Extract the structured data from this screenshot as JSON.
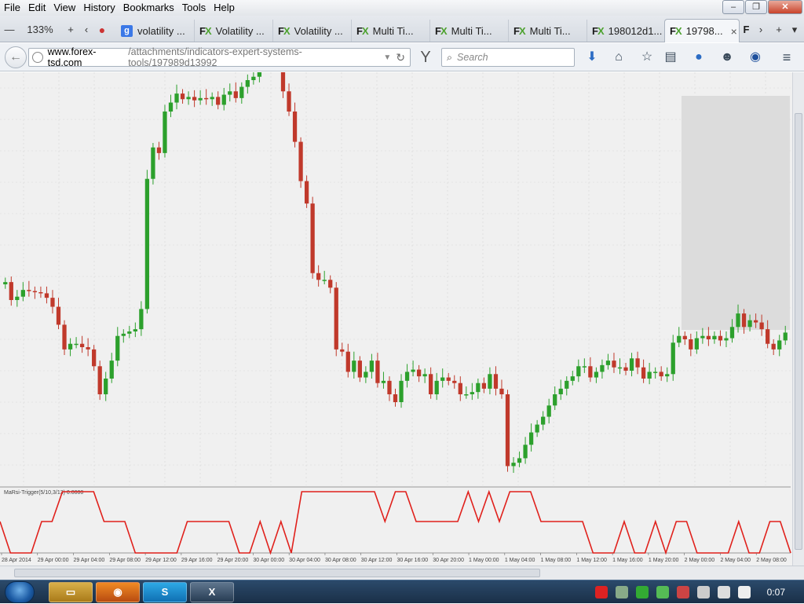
{
  "menu": [
    "File",
    "Edit",
    "View",
    "History",
    "Bookmarks",
    "Tools",
    "Help"
  ],
  "window_controls": {
    "minimize": "–",
    "restore": "❐",
    "close": "✕"
  },
  "tabbar": {
    "zoom": "133%",
    "tabs": [
      {
        "icon": "google",
        "label": "volatility ..."
      },
      {
        "icon": "fx",
        "label": "Volatility ..."
      },
      {
        "icon": "fx",
        "label": "Volatility ..."
      },
      {
        "icon": "fx",
        "label": "Multi Ti..."
      },
      {
        "icon": "fx",
        "label": "Multi Ti..."
      },
      {
        "icon": "fx",
        "label": "Multi Ti..."
      },
      {
        "icon": "fx",
        "label": "198012d1..."
      },
      {
        "icon": "fx",
        "label": "19798...",
        "active": true
      }
    ],
    "fx_logo": "FX",
    "google_logo": "g",
    "close_tab": "×",
    "newtab": "+",
    "trailing_fx": "F"
  },
  "navbar": {
    "url_host": "www.forex-tsd.com",
    "url_path": "/attachments/indicators-expert-systems-tools/197989d13992",
    "search_placeholder": "Search"
  },
  "chart_data": {
    "type": "candlestick",
    "indicator_label": "MaRsi-Trigger(5/10,3/13) 0.0000",
    "x_tick_labels": [
      "28 Apr 2014",
      "29 Apr 00:00",
      "29 Apr 04:00",
      "29 Apr 08:00",
      "29 Apr 12:00",
      "29 Apr 16:00",
      "29 Apr 20:00",
      "30 Apr 00:00",
      "30 Apr 04:00",
      "30 Apr 08:00",
      "30 Apr 12:00",
      "30 Apr 16:00",
      "30 Apr 20:00",
      "1 May 00:00",
      "1 May 04:00",
      "1 May 08:00",
      "1 May 12:00",
      "1 May 16:00",
      "1 May 20:00",
      "2 May 00:00",
      "2 May 04:00",
      "2 May 08:00"
    ],
    "colors": {
      "up": "#2ca02c",
      "down": "#c0392b",
      "indicator": "#e0201b",
      "background": "#f0f0f0",
      "grid": "#d6d6d6"
    },
    "close_values": [
      260,
      244,
      247,
      253,
      252,
      251,
      250,
      246,
      238,
      222,
      200,
      205,
      205,
      202,
      200,
      185,
      160,
      174,
      190,
      212,
      214,
      216,
      218,
      236,
      352,
      380,
      375,
      412,
      420,
      428,
      423,
      425,
      422,
      424,
      423,
      425,
      418,
      427,
      430,
      424,
      434,
      440,
      443,
      455,
      462,
      490,
      480,
      430,
      412,
      385,
      350,
      330,
      268,
      262,
      262,
      255,
      200,
      198,
      180,
      190,
      175,
      180,
      190,
      170,
      172,
      160,
      153,
      172,
      180,
      182,
      176,
      178,
      160,
      172,
      175,
      172,
      170,
      160,
      160,
      162,
      170,
      165,
      178,
      165,
      160,
      96,
      99,
      103,
      115,
      126,
      133,
      140,
      150,
      160,
      165,
      172,
      176,
      185,
      185,
      175,
      180,
      186,
      190,
      184,
      184,
      181,
      192,
      184,
      174,
      180,
      180,
      176,
      178,
      206,
      212,
      209,
      200,
      210,
      212,
      209,
      212,
      208,
      210,
      220,
      232,
      220,
      226,
      224,
      218,
      205,
      200,
      208,
      215
    ]
  },
  "indicator_data": {
    "levels": [
      "high",
      "mid",
      "low"
    ],
    "states": [
      "mid",
      "low",
      "low",
      "low",
      "mid",
      "mid",
      "high",
      "high",
      "high",
      "high",
      "mid",
      "mid",
      "mid",
      "low",
      "low",
      "low",
      "low",
      "low",
      "mid",
      "mid",
      "mid",
      "mid",
      "mid",
      "low",
      "low",
      "mid",
      "low",
      "mid",
      "low",
      "high",
      "high",
      "high",
      "high",
      "high",
      "high",
      "high",
      "high",
      "mid",
      "high",
      "high",
      "mid",
      "mid",
      "mid",
      "mid",
      "mid",
      "high",
      "mid",
      "high",
      "mid",
      "high",
      "high",
      "high",
      "mid",
      "mid",
      "mid",
      "mid",
      "mid",
      "low",
      "low",
      "low",
      "mid",
      "low",
      "low",
      "mid",
      "low",
      "mid",
      "mid",
      "low",
      "low",
      "low",
      "low",
      "mid",
      "low",
      "low",
      "mid",
      "mid",
      "low"
    ]
  },
  "taskbar": {
    "apps": [
      "explorer",
      "firefox",
      "skype",
      "x-app"
    ],
    "clock": "0:07"
  }
}
